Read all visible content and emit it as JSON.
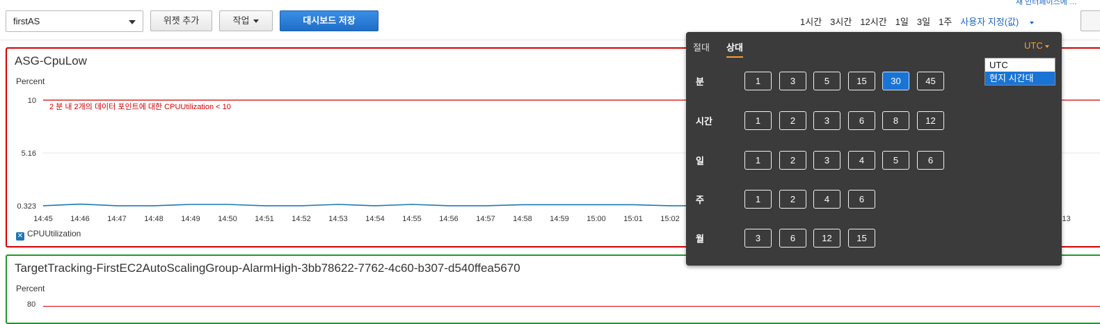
{
  "toolbar": {
    "dashboard_name": "firstAS",
    "add_widget_label": "위젯 추가",
    "actions_label": "작업",
    "save_dashboard_label": "대시보드 저장",
    "ranges": [
      "1시간",
      "3시간",
      "12시간",
      "1일",
      "3일",
      "1주"
    ],
    "custom_range_label": "사용자 지정(값)",
    "clipped_top_text": "새 인터페이스에 …"
  },
  "widget1": {
    "title": "ASG-CpuLow",
    "unit": "Percent",
    "legend_label": "CPUUtilization",
    "legend_icon": "x-icon"
  },
  "widget2": {
    "title": "TargetTracking-FirstEC2AutoScalingGroup-AlarmHigh-3bb78622-7762-4c60-b307-d540ffea5670",
    "unit": "Percent",
    "y_top_label": "80"
  },
  "popover": {
    "tab_absolute": "절대",
    "tab_relative": "상대",
    "timezone_label": "UTC",
    "timezone_options": [
      "UTC",
      "현지 시간대"
    ],
    "timezone_selected_index": 1,
    "rows": [
      {
        "label": "분",
        "options": [
          "1",
          "3",
          "5",
          "15",
          "30",
          "45"
        ],
        "active_index": 4
      },
      {
        "label": "시간",
        "options": [
          "1",
          "2",
          "3",
          "6",
          "8",
          "12"
        ],
        "active_index": -1
      },
      {
        "label": "일",
        "options": [
          "1",
          "2",
          "3",
          "4",
          "5",
          "6"
        ],
        "active_index": -1
      },
      {
        "label": "주",
        "options": [
          "1",
          "2",
          "4",
          "6"
        ],
        "active_index": -1
      },
      {
        "label": "월",
        "options": [
          "3",
          "6",
          "12",
          "15"
        ],
        "active_index": -1
      }
    ]
  },
  "chart_data": {
    "type": "line",
    "title": "ASG-CpuLow",
    "ylabel": "Percent",
    "ylim": [
      0.323,
      10
    ],
    "yticks": [
      "10",
      "5.16",
      "0.323"
    ],
    "x": [
      "14:45",
      "14:46",
      "14:47",
      "14:48",
      "14:49",
      "14:50",
      "14:51",
      "14:52",
      "14:53",
      "14:54",
      "14:55",
      "14:56",
      "14:57",
      "14:58",
      "14:59",
      "15:00",
      "15:01",
      "15:02",
      "15:13"
    ],
    "threshold": {
      "value": 10,
      "label": "2 분 내 2개의 데이터 포인트에 대한 CPUUtilization < 10",
      "color": "#d40000"
    },
    "series": [
      {
        "name": "CPUUtilization",
        "color": "#1f77b4",
        "values": [
          0.33,
          0.48,
          0.33,
          0.33,
          0.45,
          0.45,
          0.33,
          0.33,
          0.45,
          0.33,
          0.45,
          0.33,
          0.33,
          0.42,
          0.42,
          0.42,
          0.42,
          0.33,
          0.4
        ]
      }
    ]
  }
}
